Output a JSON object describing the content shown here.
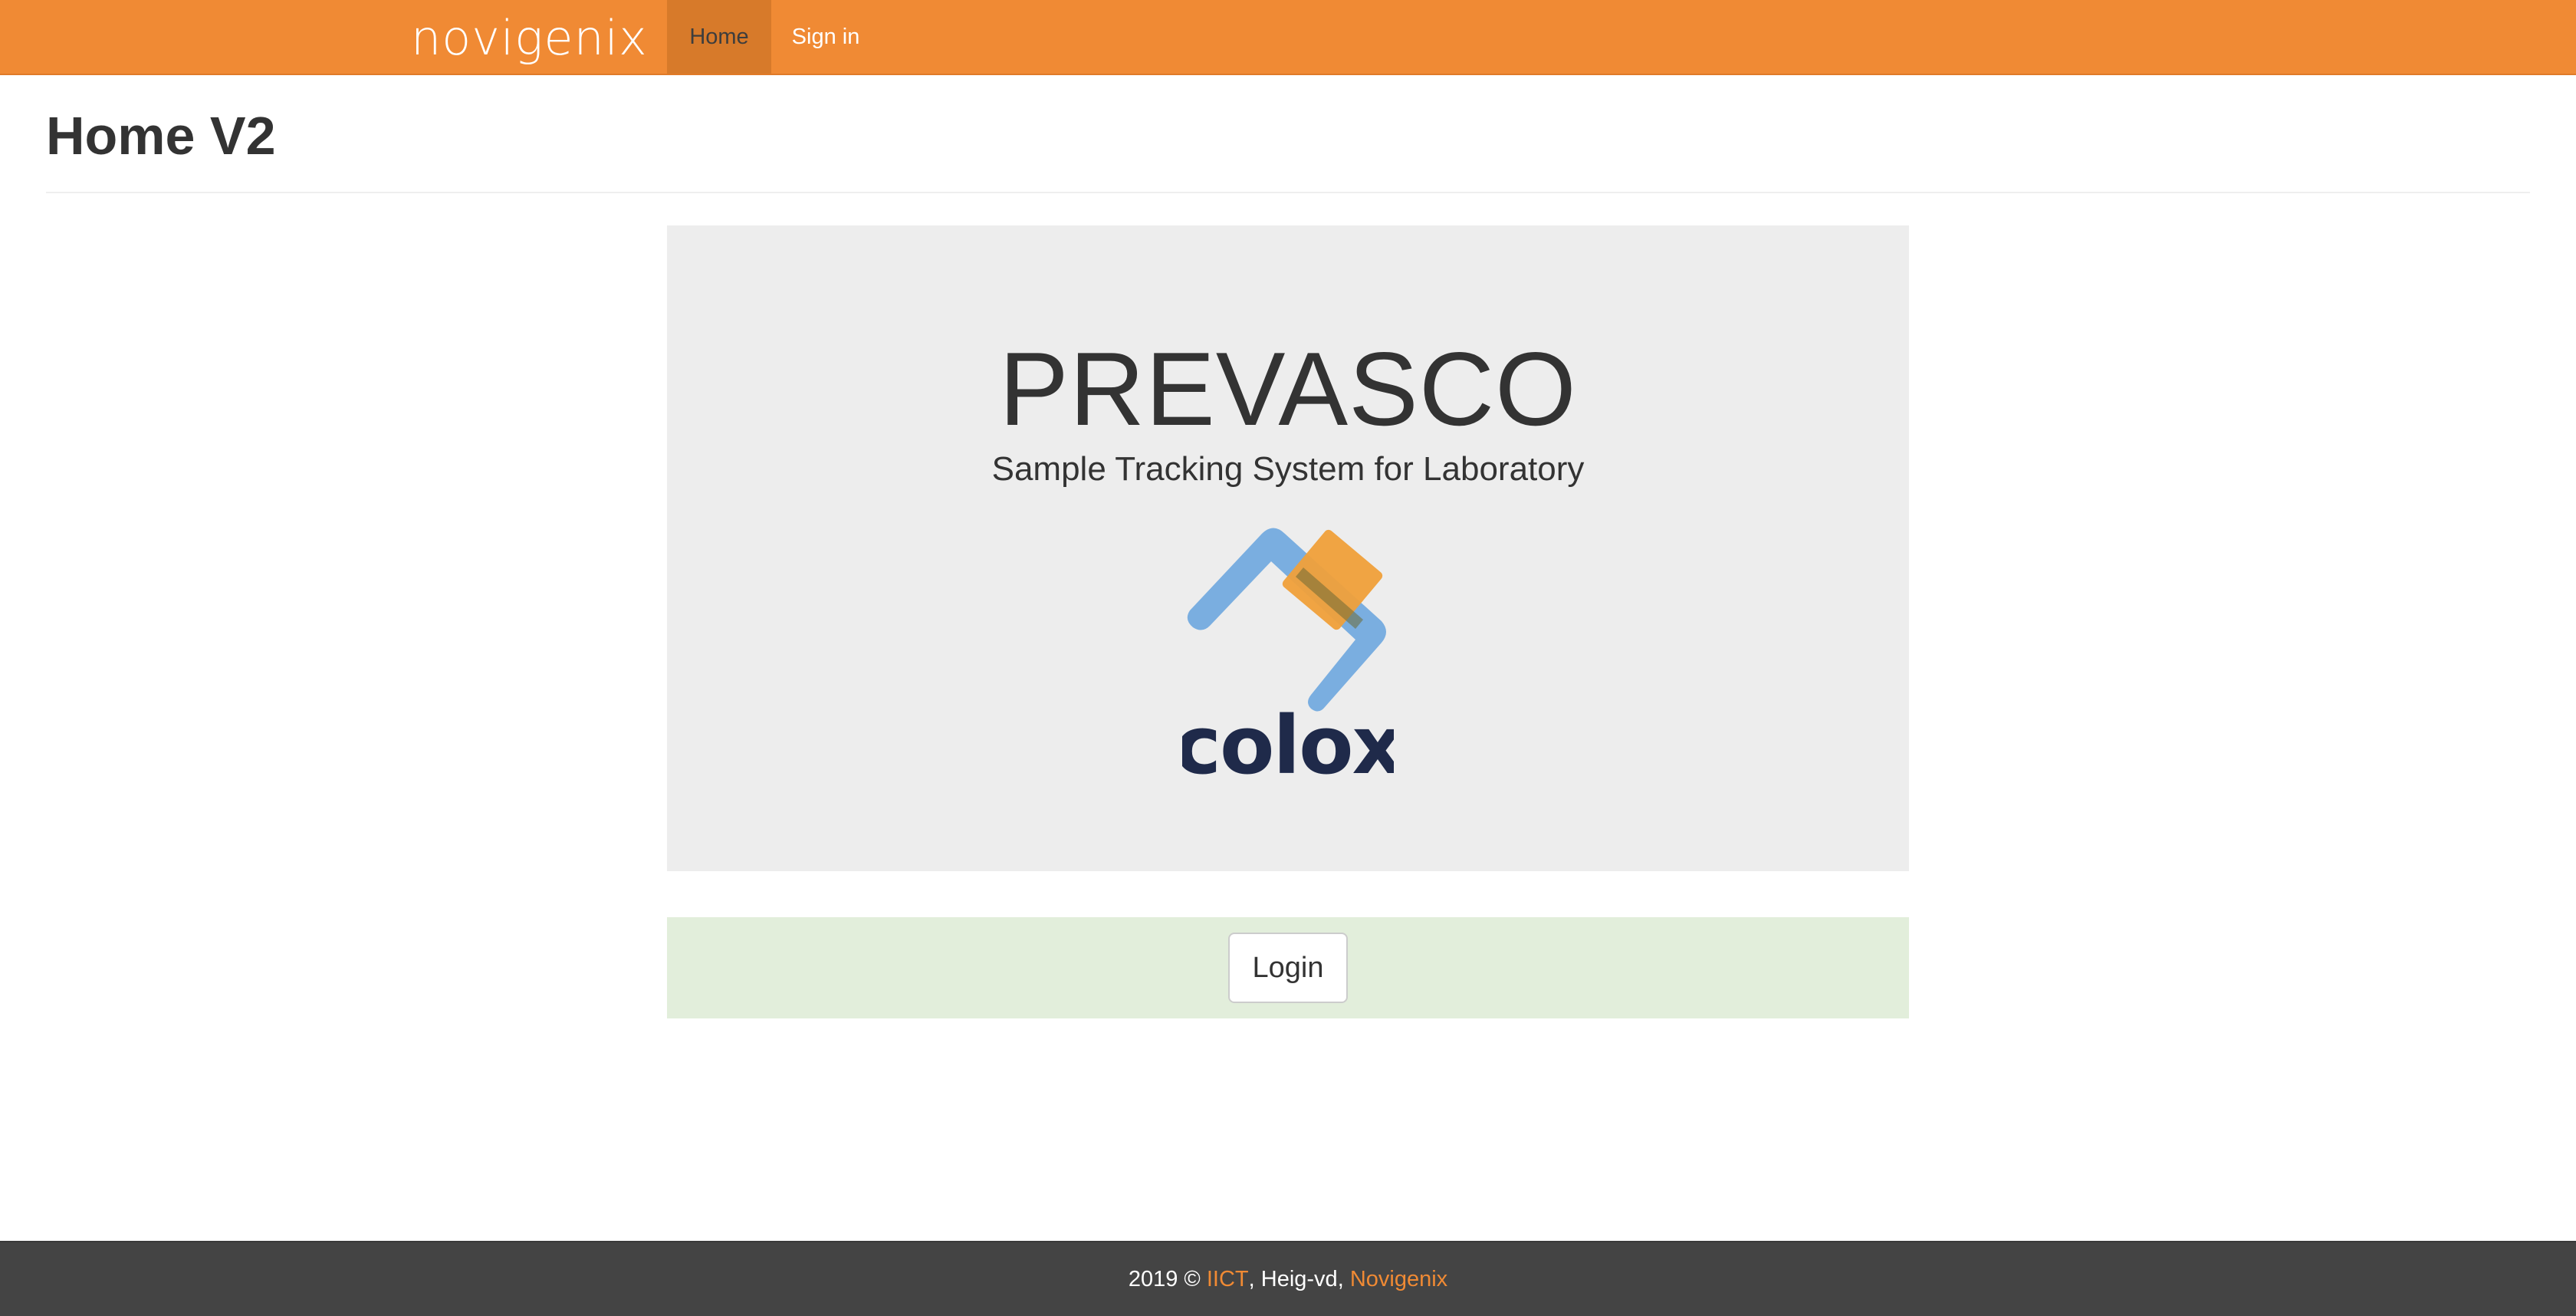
{
  "navbar": {
    "brand": "novigenix",
    "links": [
      {
        "label": "Home",
        "active": true
      },
      {
        "label": "Sign in",
        "active": false
      }
    ],
    "background_color": "#f08a34",
    "active_color": "#d77a2a"
  },
  "page": {
    "title": "Home V2"
  },
  "jumbotron": {
    "title": "PREVASCO",
    "subtitle": "Sample Tracking System for Laboratory",
    "logo_text": "colox",
    "logo_icon": "colox-logo-icon",
    "background_color": "#ededed"
  },
  "login_panel": {
    "button_label": "Login",
    "background_color": "#e2eedb"
  },
  "footer": {
    "prefix": "2019 ©",
    "org1": "IICT",
    "separator1": ",",
    "org2": "Heig-vd",
    "separator2": ",",
    "org3": "Novigenix",
    "link_color": "#f08a34",
    "background_color": "#444444"
  }
}
